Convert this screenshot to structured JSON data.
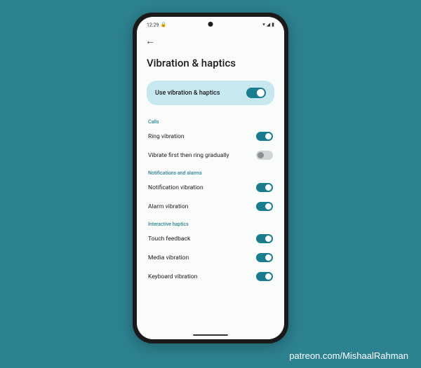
{
  "status": {
    "time": "12:29",
    "lock_icon": "🔒",
    "wifi_icon": "▾",
    "signal_icon": "◢",
    "battery_icon": "▮"
  },
  "page": {
    "title": "Vibration & haptics",
    "back_icon": "←"
  },
  "hero": {
    "label": "Use vibration & haptics",
    "on": true
  },
  "sections": [
    {
      "header": "Calls",
      "items": [
        {
          "label": "Ring vibration",
          "on": true
        },
        {
          "label": "Vibrate first then ring gradually",
          "on": false
        }
      ]
    },
    {
      "header": "Notifications and alarms",
      "items": [
        {
          "label": "Notification vibration",
          "on": true
        },
        {
          "label": "Alarm vibration",
          "on": true
        }
      ]
    },
    {
      "header": "Interactive haptics",
      "items": [
        {
          "label": "Touch feedback",
          "on": true
        },
        {
          "label": "Media vibration",
          "on": true
        },
        {
          "label": "Keyboard vibration",
          "on": true
        }
      ]
    }
  ],
  "credit": "patreon.com/MishaalRahman"
}
